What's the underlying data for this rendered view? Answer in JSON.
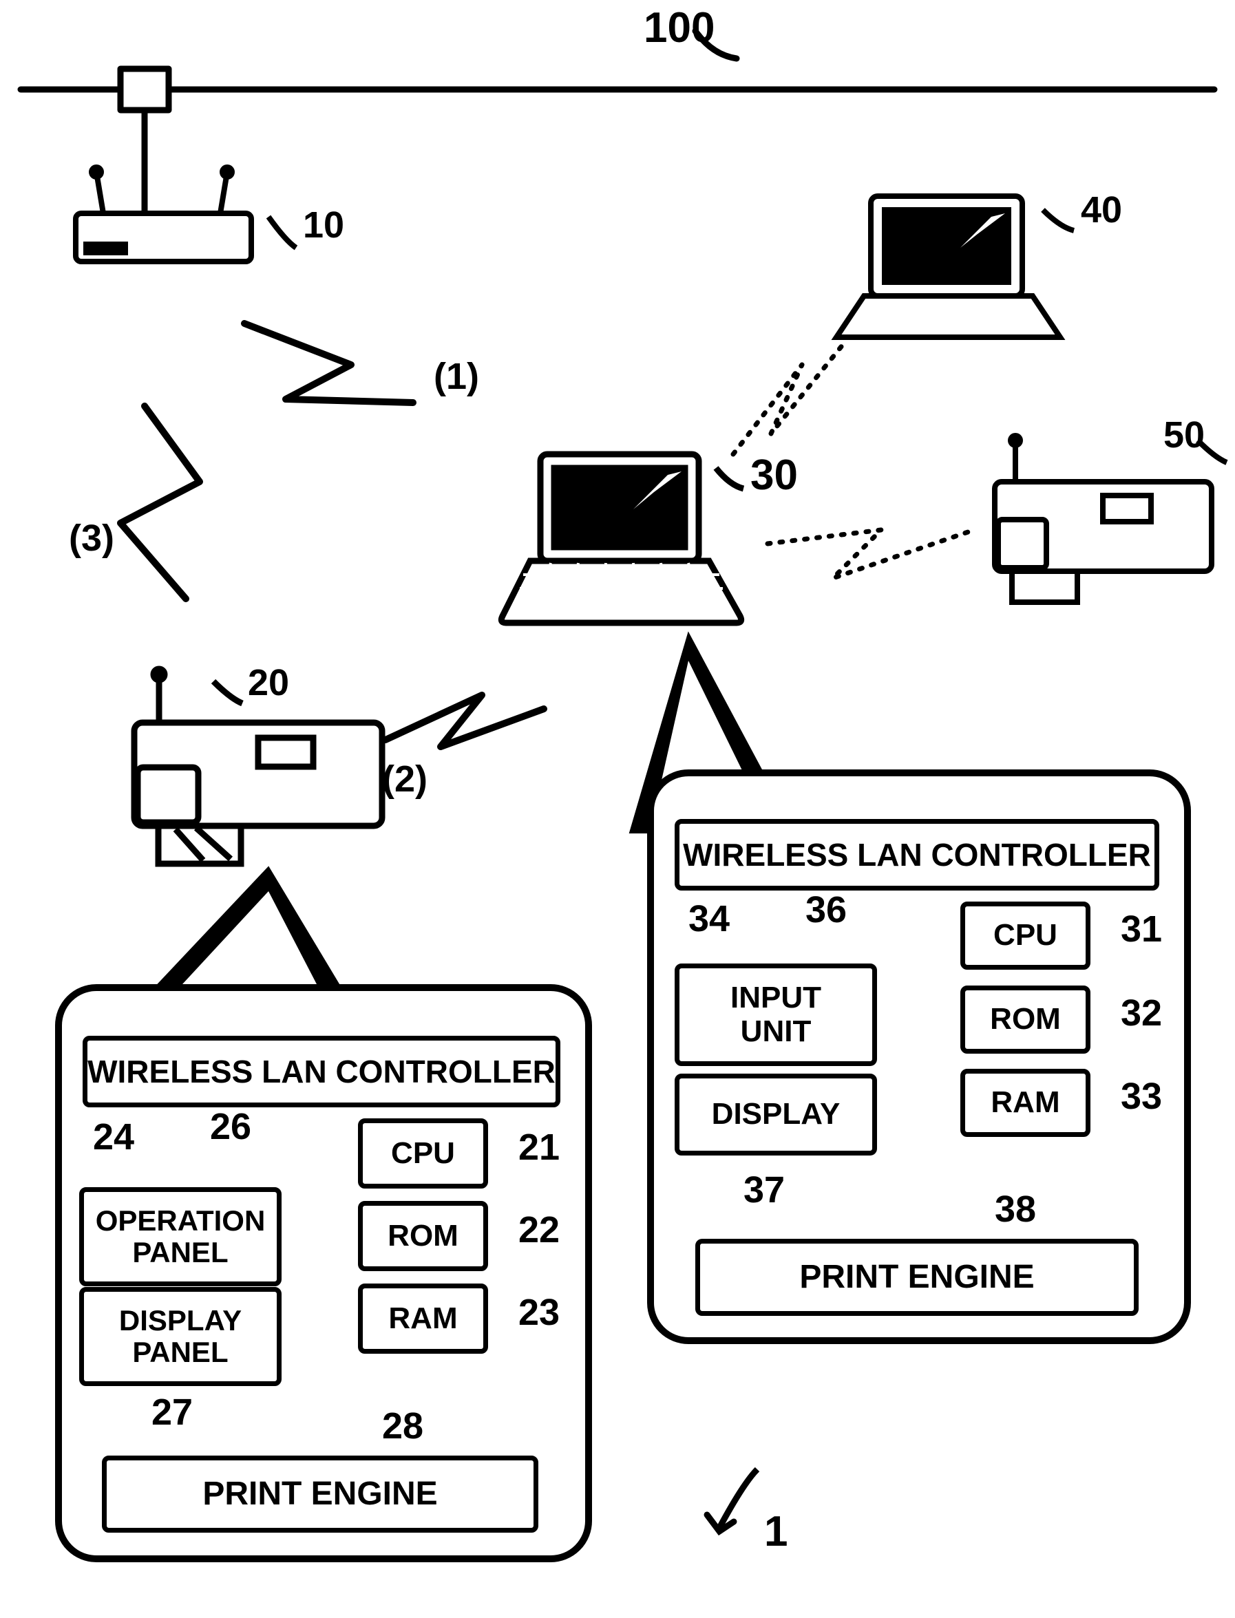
{
  "refs": {
    "network": "100",
    "access_point": "10",
    "printer_a": "20",
    "laptop_a": "30",
    "laptop_b": "40",
    "printer_b": "50",
    "system": "1"
  },
  "links": {
    "l1": "(1)",
    "l2": "(2)",
    "l3": "(3)"
  },
  "block_a": {
    "wlan": "WIRELESS LAN CONTROLLER",
    "wlan_ref": "24",
    "bus_ref": "26",
    "cpu": "CPU",
    "cpu_ref": "21",
    "rom": "ROM",
    "rom_ref": "22",
    "ram": "RAM",
    "ram_ref": "23",
    "op_panel": "OPERATION\nPANEL",
    "disp_panel": "DISPLAY\nPANEL",
    "disp_ref": "27",
    "engine": "PRINT ENGINE",
    "engine_ref": "28"
  },
  "block_b": {
    "wlan": "WIRELESS LAN CONTROLLER",
    "wlan_ref": "34",
    "bus_ref": "36",
    "cpu": "CPU",
    "cpu_ref": "31",
    "rom": "ROM",
    "rom_ref": "32",
    "ram": "RAM",
    "ram_ref": "33",
    "input": "INPUT\nUNIT",
    "display": "DISPLAY",
    "disp_ref": "37",
    "engine": "PRINT ENGINE",
    "engine_ref": "38"
  }
}
